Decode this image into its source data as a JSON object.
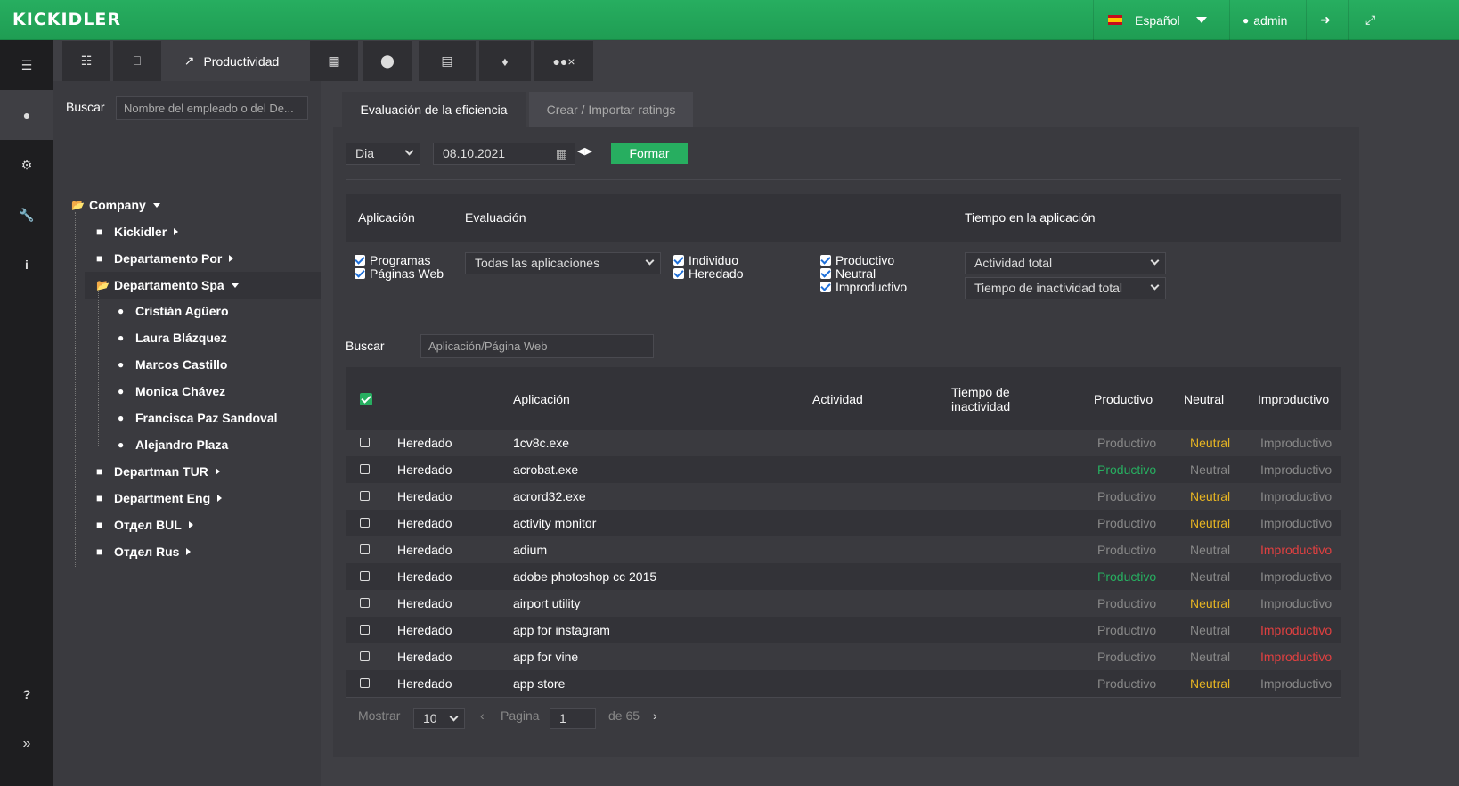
{
  "app": {
    "logo": "KICKIDLER"
  },
  "topbar": {
    "language": "Español",
    "user": "admin"
  },
  "colors": {
    "accent": "#27ae60",
    "neutral": "#e6b422",
    "unproductive": "#e04040",
    "productive": "#27ae60"
  },
  "sidebar": {
    "items": [
      {
        "icon": "list-icon"
      },
      {
        "icon": "user-icon"
      },
      {
        "icon": "gears-icon"
      },
      {
        "icon": "wrench-icon"
      },
      {
        "icon": "info-icon"
      }
    ],
    "help": "?",
    "expand": "»"
  },
  "toolbar": {
    "productivity_label": "Productividad"
  },
  "tree": {
    "search_label": "Buscar",
    "search_placeholder": "Nombre del empleado o del De...",
    "root": "Company",
    "nodes": [
      "Kickidler",
      "Departamento Por",
      "Departamento Spa",
      "Cristián Agüero",
      "Laura Blázquez",
      "Marcos Castillo",
      "Monica Chávez",
      "Francisca Paz Sandoval",
      "Alejandro Plaza",
      "Departman TUR",
      "Department Eng",
      "Отдел BUL",
      "Отдел Rus"
    ]
  },
  "main": {
    "tabs": [
      "Evaluación de la eficiencia",
      "Crear / Importar ratings"
    ],
    "period": "Dia",
    "date": "08.10.2021",
    "form_button": "Formar",
    "filters": {
      "app_label": "Aplicación",
      "eval_label": "Evaluación",
      "time_label": "Tiempo en la aplicación",
      "programs": "Programas",
      "websites": "Páginas Web",
      "all_apps": "Todas las aplicaciones",
      "individual": "Individuo",
      "inherited": "Heredado",
      "productive": "Productivo",
      "neutral": "Neutral",
      "unproductive": "Improductivo",
      "activity_total": "Actividad total",
      "idle_total": "Tiempo de inactividad total"
    },
    "search_label": "Buscar",
    "search_placeholder": "Aplicación/Página Web",
    "table": {
      "headers": [
        "Aplicación",
        "Actividad",
        "Tiempo de",
        "inactividad",
        "Productivo",
        "Neutral",
        "Improductivo"
      ],
      "rows": [
        {
          "source": "Heredado",
          "app": "1cv8c.exe",
          "rating": "neutral"
        },
        {
          "source": "Heredado",
          "app": "acrobat.exe",
          "rating": "productive"
        },
        {
          "source": "Heredado",
          "app": "acrord32.exe",
          "rating": "neutral"
        },
        {
          "source": "Heredado",
          "app": "activity monitor",
          "rating": "neutral"
        },
        {
          "source": "Heredado",
          "app": "adium",
          "rating": "unproductive"
        },
        {
          "source": "Heredado",
          "app": "adobe photoshop cc 2015",
          "rating": "productive"
        },
        {
          "source": "Heredado",
          "app": "airport utility",
          "rating": "neutral"
        },
        {
          "source": "Heredado",
          "app": "app for instagram",
          "rating": "unproductive"
        },
        {
          "source": "Heredado",
          "app": "app for vine",
          "rating": "unproductive"
        },
        {
          "source": "Heredado",
          "app": "app store",
          "rating": "neutral"
        }
      ]
    },
    "pager": {
      "show_label": "Mostrar",
      "page_size": "10",
      "page_label": "Pagina",
      "page": "1",
      "of_label": "de 65"
    }
  }
}
